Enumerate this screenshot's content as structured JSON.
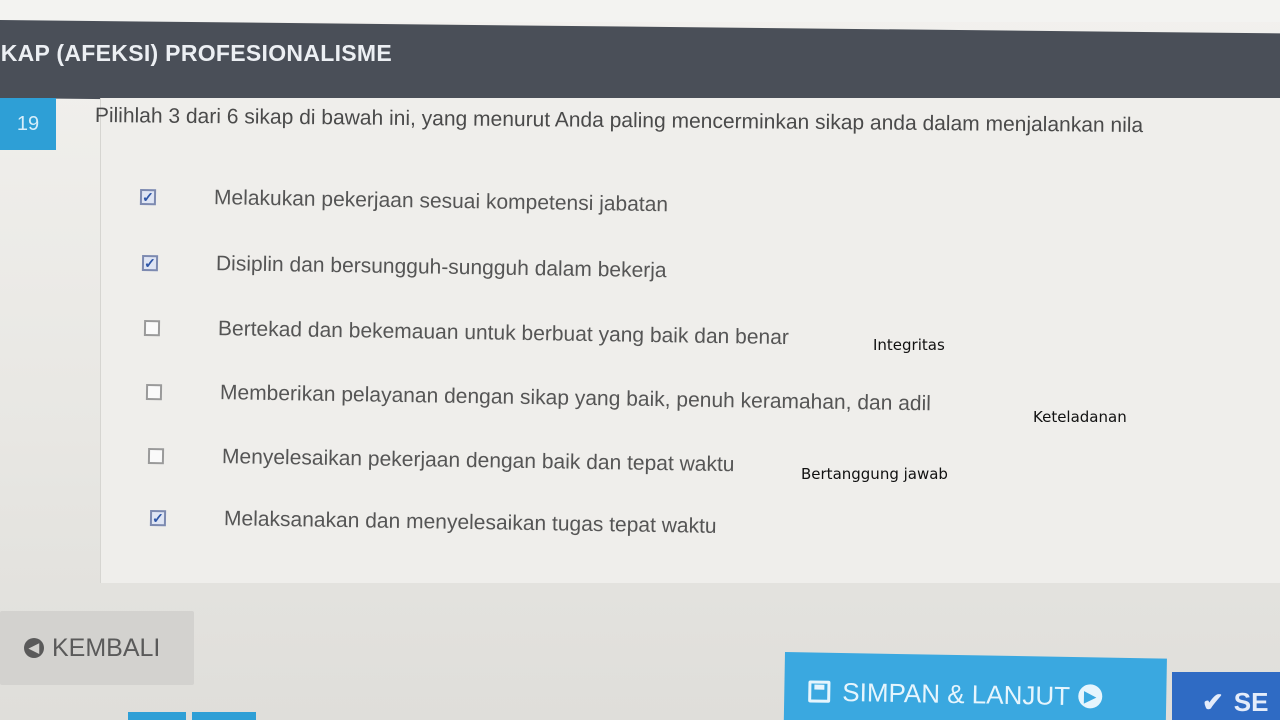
{
  "header": {
    "section_title": "IKAP (AFEKSI) PROFESIONALISME"
  },
  "question": {
    "number": "19",
    "text": "Pilihlah 3 dari 6 sikap di bawah ini, yang menurut Anda paling mencerminkan sikap anda dalam menjalankan nila",
    "options": [
      {
        "label": "Melakukan pekerjaan sesuai kompetensi jabatan",
        "checked": true
      },
      {
        "label": "Disiplin dan bersungguh-sungguh dalam bekerja",
        "checked": true
      },
      {
        "label": "Bertekad dan bekemauan untuk berbuat yang baik dan benar",
        "checked": false
      },
      {
        "label": "Memberikan pelayanan dengan sikap yang baik, penuh keramahan, dan adil",
        "checked": false
      },
      {
        "label": "Menyelesaikan pekerjaan dengan baik dan tepat waktu",
        "checked": false
      },
      {
        "label": "Melaksanakan dan menyelesaikan tugas tepat waktu",
        "checked": true
      }
    ]
  },
  "annotations": [
    "Integritas",
    "Keteladanan",
    "Bertanggung jawab"
  ],
  "buttons": {
    "back_label": "KEMBALI",
    "save_label": "SIMPAN & LANJUT",
    "finish_label": "SE"
  },
  "icons": {
    "back": "arrow-left-circle-icon",
    "save": "floppy-disk-icon",
    "next": "arrow-right-circle-icon",
    "finish": "check-icon"
  },
  "colors": {
    "header_bg": "#4a4f58",
    "accent_blue": "#3aa8e0",
    "number_badge": "#2e9fd6",
    "finish_blue": "#2f6bc4"
  }
}
